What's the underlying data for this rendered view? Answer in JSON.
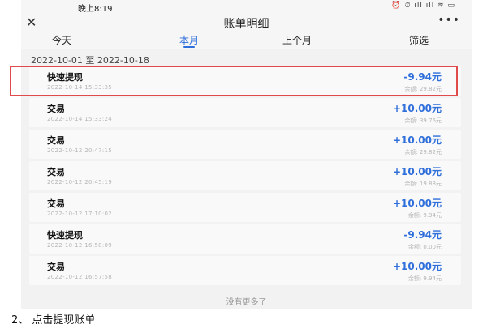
{
  "status_bar": {
    "time": "晚上8:19",
    "icons": "⏰ ⏱ ıll ıll ≋ ▭"
  },
  "header": {
    "close_glyph": "✕",
    "title": "账单明细",
    "more_glyph": "•••"
  },
  "tabs": [
    {
      "label": "今天",
      "active": false
    },
    {
      "label": "本月",
      "active": true
    },
    {
      "label": "上个月",
      "active": false
    },
    {
      "label": "筛选",
      "active": false
    }
  ],
  "date_range": "2022-10-01 至 2022-10-18",
  "transactions": [
    {
      "name": "快速提现",
      "time": "2022-10-14 15:33:35",
      "amount": "-9.94元",
      "balance": "余额: 29.82元",
      "highlighted": true
    },
    {
      "name": "交易",
      "time": "2022-10-14 15:33:24",
      "amount": "+10.00元",
      "balance": "余额: 39.76元"
    },
    {
      "name": "交易",
      "time": "2022-10-12 20:47:15",
      "amount": "+10.00元",
      "balance": "余额: 29.82元"
    },
    {
      "name": "交易",
      "time": "2022-10-12 20:45:19",
      "amount": "+10.00元",
      "balance": "余额: 19.88元"
    },
    {
      "name": "交易",
      "time": "2022-10-12 17:10:02",
      "amount": "+10.00元",
      "balance": "余额: 9.94元"
    },
    {
      "name": "快速提现",
      "time": "2022-10-12 16:58:09",
      "amount": "-9.94元",
      "balance": "余额: 0.00元"
    },
    {
      "name": "交易",
      "time": "2022-10-12 16:57:58",
      "amount": "+10.00元",
      "balance": "余额: 9.94元"
    }
  ],
  "footer": {
    "no_more": "没有更多了"
  },
  "caption": "2、 点击提现账单",
  "colors": {
    "accent": "#2f6fdb",
    "highlight": "#e04a4a"
  }
}
